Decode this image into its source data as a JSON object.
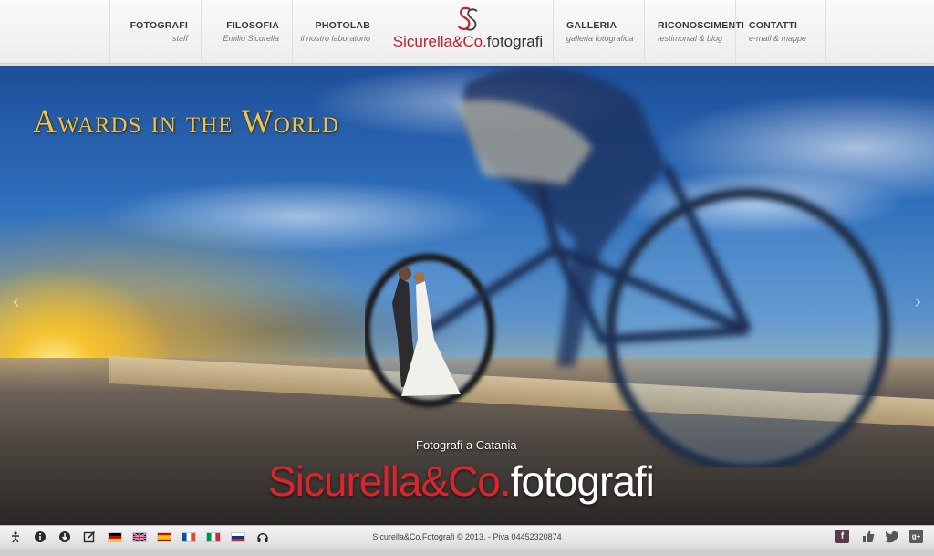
{
  "nav": {
    "items": [
      {
        "title": "FOTOGRAFI",
        "subtitle": "staff"
      },
      {
        "title": "FILOSOFIA",
        "subtitle": "Emilio Sicurella"
      },
      {
        "title": "PHOTOLAB",
        "subtitle": "il nostro laboratorio"
      },
      {
        "title": "GALLERIA",
        "subtitle": "galleria fotografica"
      },
      {
        "title": "RICONOSCIMENTI",
        "subtitle": "testimonial & blog"
      },
      {
        "title": "CONTATTI",
        "subtitle": "e-mail & mappe"
      }
    ],
    "logo": {
      "brand_red": "Sicurella&Co.",
      "brand_dark": "fotografi"
    }
  },
  "hero": {
    "title": "Awards in the World",
    "subtitle": "Fotografi a Catania",
    "brand_red": "Sicurella&Co.",
    "brand_white": "fotografi",
    "prev_arrow": "‹",
    "next_arrow": "›"
  },
  "footer": {
    "copyright": "Sicurella&Co.Fotografi © 2013. - Piva 04452320874",
    "left_icons": [
      "accessibility-icon",
      "info-icon",
      "download-icon",
      "edit-icon",
      "headphones-icon"
    ],
    "languages": [
      "de",
      "en",
      "es",
      "fr",
      "it",
      "ru"
    ],
    "social_icons": [
      "facebook-icon",
      "like-icon",
      "twitter-icon",
      "google-plus-icon"
    ]
  },
  "colors": {
    "brand_red": "#c0202a",
    "gold_title": "#e8c25a"
  }
}
